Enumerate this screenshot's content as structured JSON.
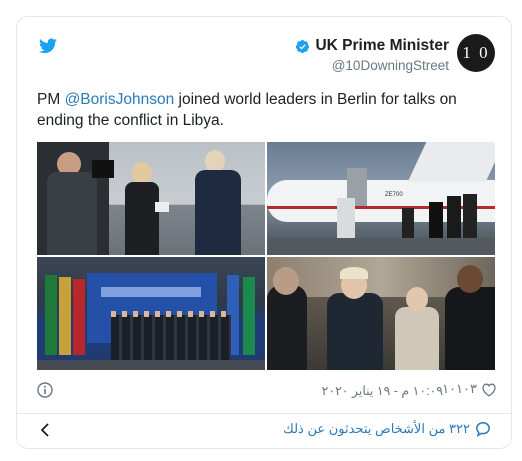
{
  "header": {
    "display_name": "UK Prime Minister",
    "handle": "@10DowningStreet",
    "avatar_text": "1 0",
    "verified": true
  },
  "tweet": {
    "prefix": "PM ",
    "mention": "@BorisJohnson",
    "suffix": " joined world leaders in Berlin for talks on ending the conflict in Libya."
  },
  "photos": [
    {
      "caption": "",
      "text": "ZE700"
    },
    {
      "caption": "",
      "text": ""
    },
    {
      "caption": "",
      "text": ""
    },
    {
      "caption": "",
      "text": ""
    }
  ],
  "meta": {
    "likes": "١٠١٠٣",
    "timestamp": "١٠:٠٩ م - ١٩ يناير ٢٠٢٠"
  },
  "footer": {
    "conversation_text": "٣٢٢ من الأشخاص يتحدثون عن ذلك"
  },
  "colors": {
    "link": "#2b7bb9",
    "twitter_blue": "#1da1f2",
    "muted": "#697882",
    "border": "#e1e8ed"
  },
  "icons": [
    "twitter-logo-icon",
    "verified-badge-icon",
    "info-icon",
    "heart-icon",
    "speech-bubble-icon",
    "chevron-left-icon"
  ]
}
